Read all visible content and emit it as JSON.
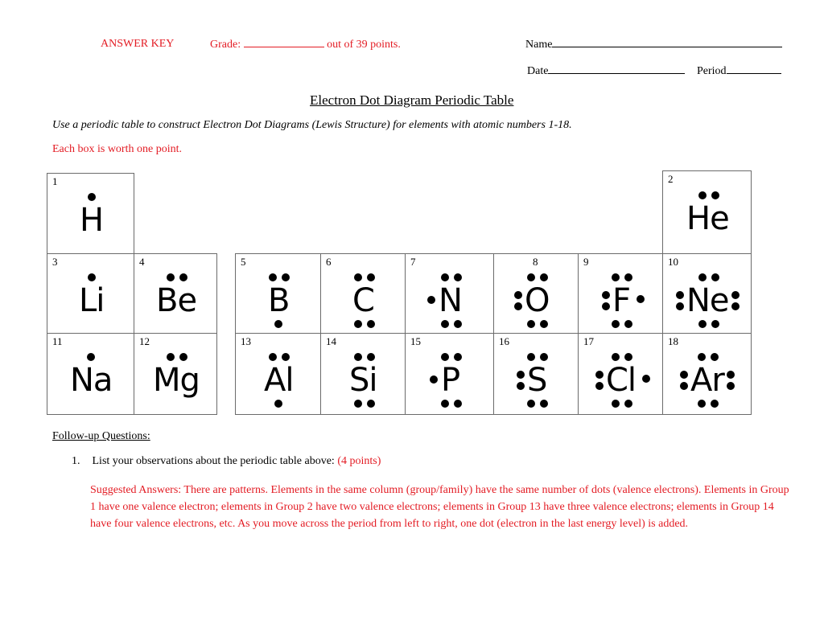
{
  "header": {
    "answer_key": "ANSWER KEY",
    "grade_label": "Grade:",
    "grade_suffix": "out of 39 points.",
    "name_label": "Name",
    "date_label": "Date",
    "period_label": "Period"
  },
  "title": "Electron Dot Diagram Periodic Table",
  "instructions": "Use a periodic table to construct Electron Dot Diagrams (Lewis Structure) for elements with atomic numbers 1-18.",
  "scoring_note": "Each box is worth one point.",
  "elements": [
    {
      "number": "1",
      "symbol": "H",
      "valence_dots": 1
    },
    {
      "number": "2",
      "symbol": "He",
      "valence_dots": 2
    },
    {
      "number": "3",
      "symbol": "Li",
      "valence_dots": 1
    },
    {
      "number": "4",
      "symbol": "Be",
      "valence_dots": 2
    },
    {
      "number": "5",
      "symbol": "B",
      "valence_dots": 3
    },
    {
      "number": "6",
      "symbol": "C",
      "valence_dots": 4
    },
    {
      "number": "7",
      "symbol": "N",
      "valence_dots": 5
    },
    {
      "number": "8",
      "symbol": "O",
      "valence_dots": 6
    },
    {
      "number": "9",
      "symbol": "F",
      "valence_dots": 7
    },
    {
      "number": "10",
      "symbol": "Ne",
      "valence_dots": 8
    },
    {
      "number": "11",
      "symbol": "Na",
      "valence_dots": 1
    },
    {
      "number": "12",
      "symbol": "Mg",
      "valence_dots": 2
    },
    {
      "number": "13",
      "symbol": "Al",
      "valence_dots": 3
    },
    {
      "number": "14",
      "symbol": "Si",
      "valence_dots": 4
    },
    {
      "number": "15",
      "symbol": "P",
      "valence_dots": 5
    },
    {
      "number": "16",
      "symbol": "S",
      "valence_dots": 6
    },
    {
      "number": "17",
      "symbol": "Cl",
      "valence_dots": 7
    },
    {
      "number": "18",
      "symbol": "Ar",
      "valence_dots": 8
    }
  ],
  "followup": {
    "heading": "Follow-up Questions:",
    "questions": [
      {
        "number": "1.",
        "text": "List your observations about the periodic table above:",
        "points": "(4 points)",
        "answer": "Suggested Answers:  There are patterns.  Elements in the same column (group/family) have the same number of dots (valence electrons).  Elements in Group 1 have one valence electron; elements in Group 2 have two valence electrons; elements in Group 13 have three valence electrons; elements in Group 14 have four valence electrons, etc.  As you move across the period from left to right, one dot (electron in the last energy level) is added."
      }
    ]
  }
}
